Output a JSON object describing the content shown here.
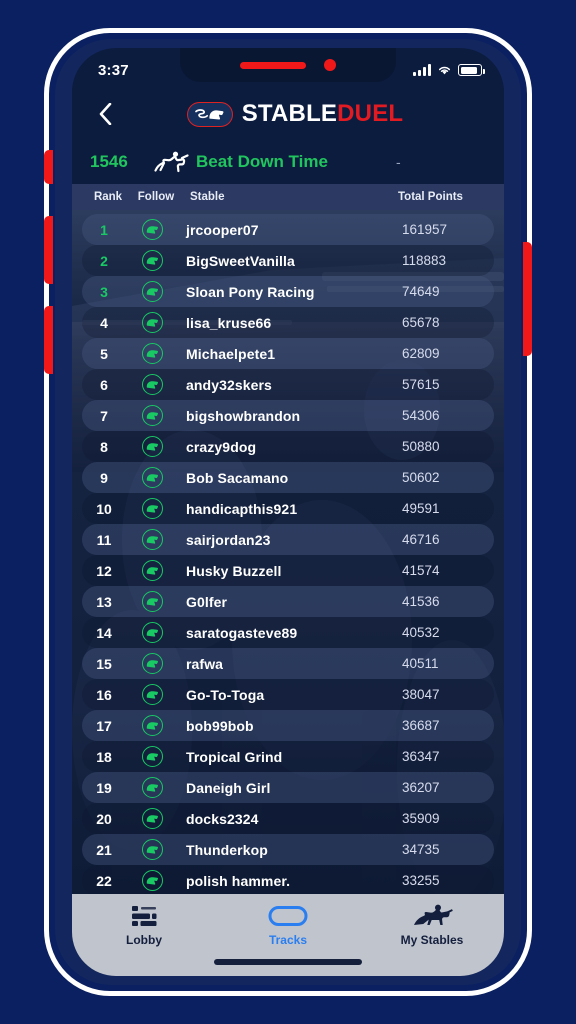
{
  "status_bar": {
    "time": "3:37",
    "signal_icon": "signal-bars-icon",
    "wifi_icon": "wifi-icon",
    "battery_icon": "battery-icon"
  },
  "header": {
    "back_icon": "chevron-left-icon",
    "logo_badge_icon": "stableduel-horse-badge-icon",
    "logo_first": "STABLE",
    "logo_second": "DUEL"
  },
  "race": {
    "id": "1546",
    "horse_icon": "racehorse-jockey-icon",
    "name": "Beat Down Time",
    "extra": "-"
  },
  "table": {
    "columns": {
      "rank": "Rank",
      "follow": "Follow",
      "stable": "Stable",
      "points": "Total Points"
    },
    "rows": [
      {
        "rank": "1",
        "stable": "jrcooper07",
        "points": "161957",
        "follow_icon": "follow-horse-icon"
      },
      {
        "rank": "2",
        "stable": "BigSweetVanilla",
        "points": "118883",
        "follow_icon": "follow-horse-icon"
      },
      {
        "rank": "3",
        "stable": "Sloan Pony Racing",
        "points": "74649",
        "follow_icon": "follow-horse-icon"
      },
      {
        "rank": "4",
        "stable": "lisa_kruse66",
        "points": "65678",
        "follow_icon": "follow-horse-icon"
      },
      {
        "rank": "5",
        "stable": "Michaelpete1",
        "points": "62809",
        "follow_icon": "follow-horse-icon"
      },
      {
        "rank": "6",
        "stable": "andy32skers",
        "points": "57615",
        "follow_icon": "follow-horse-icon"
      },
      {
        "rank": "7",
        "stable": "bigshowbrandon",
        "points": "54306",
        "follow_icon": "follow-horse-icon"
      },
      {
        "rank": "8",
        "stable": "crazy9dog",
        "points": "50880",
        "follow_icon": "follow-horse-icon"
      },
      {
        "rank": "9",
        "stable": "Bob Sacamano",
        "points": "50602",
        "follow_icon": "follow-horse-icon"
      },
      {
        "rank": "10",
        "stable": "handicapthis921",
        "points": "49591",
        "follow_icon": "follow-horse-icon"
      },
      {
        "rank": "11",
        "stable": "sairjordan23",
        "points": "46716",
        "follow_icon": "follow-horse-icon"
      },
      {
        "rank": "12",
        "stable": "Husky Buzzell",
        "points": "41574",
        "follow_icon": "follow-horse-icon"
      },
      {
        "rank": "13",
        "stable": "G0lfer",
        "points": "41536",
        "follow_icon": "follow-horse-icon"
      },
      {
        "rank": "14",
        "stable": "saratogasteve89",
        "points": "40532",
        "follow_icon": "follow-horse-icon"
      },
      {
        "rank": "15",
        "stable": "rafwa",
        "points": "40511",
        "follow_icon": "follow-horse-icon"
      },
      {
        "rank": "16",
        "stable": "Go-To-Toga",
        "points": "38047",
        "follow_icon": "follow-horse-icon"
      },
      {
        "rank": "17",
        "stable": "bob99bob",
        "points": "36687",
        "follow_icon": "follow-horse-icon"
      },
      {
        "rank": "18",
        "stable": "Tropical Grind",
        "points": "36347",
        "follow_icon": "follow-horse-icon"
      },
      {
        "rank": "19",
        "stable": "Daneigh Girl",
        "points": "36207",
        "follow_icon": "follow-horse-icon"
      },
      {
        "rank": "20",
        "stable": "docks2324",
        "points": "35909",
        "follow_icon": "follow-horse-icon"
      },
      {
        "rank": "21",
        "stable": "Thunderkop",
        "points": "34735",
        "follow_icon": "follow-horse-icon"
      },
      {
        "rank": "22",
        "stable": "polish hammer.",
        "points": "33255",
        "follow_icon": "follow-horse-icon"
      }
    ]
  },
  "bottom_nav": {
    "items": [
      {
        "label": "Lobby",
        "icon": "dashboard-grid-icon",
        "active": false
      },
      {
        "label": "Tracks",
        "icon": "race-track-oval-icon",
        "active": true
      },
      {
        "label": "My Stables",
        "icon": "racehorse-jockey-icon",
        "active": false
      }
    ]
  },
  "colors": {
    "page_background": "#0a2060",
    "screen_background": "#0c1c3f",
    "accent_green": "#18c964",
    "accent_red": "#e21b22",
    "accent_blue": "#2a7ef0",
    "nav_background": "#bfc4cd",
    "table_header_background": "#2c3a63"
  }
}
